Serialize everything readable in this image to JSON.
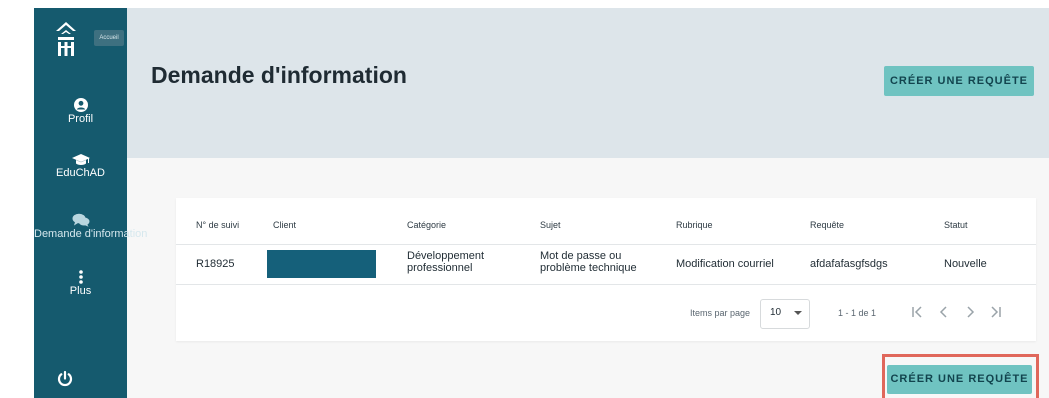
{
  "sidebar": {
    "home_tooltip": "Accueil",
    "items": [
      {
        "label": "Profil",
        "icon": "user-circle-icon"
      },
      {
        "label": "EduChAD",
        "icon": "graduation-cap-icon"
      },
      {
        "label": "Demande d'information",
        "icon": "chat-bubbles-icon",
        "active": true
      },
      {
        "label": "Plus",
        "icon": "vertical-ellipsis-icon"
      }
    ],
    "logout_icon": "power-icon"
  },
  "header": {
    "title": "Demande d'information",
    "create_button": "CRÉER UNE REQUÊTE"
  },
  "table": {
    "columns": [
      "N° de suivi",
      "Client",
      "Catégorie",
      "Sujet",
      "Rubrique",
      "Requête",
      "Statut"
    ],
    "rows": [
      {
        "tracking": "R18925",
        "client": "",
        "category_line1": "Développement",
        "category_line2": "professionnel",
        "subject_line1": "Mot de passe ou",
        "subject_line2": "problème technique",
        "rubric": "Modification courriel",
        "request": "afdafafasgfsdgs",
        "status": "Nouvelle"
      }
    ]
  },
  "pagination": {
    "items_per_page_label": "Items par page",
    "items_per_page_value": "10",
    "range": "1 - 1 de 1"
  },
  "footer": {
    "create_button": "CRÉER UNE REQUÊTE"
  },
  "colors": {
    "sidebar": "#155a6e",
    "accent": "#6fc3c1",
    "highlight": "#e0675b"
  }
}
